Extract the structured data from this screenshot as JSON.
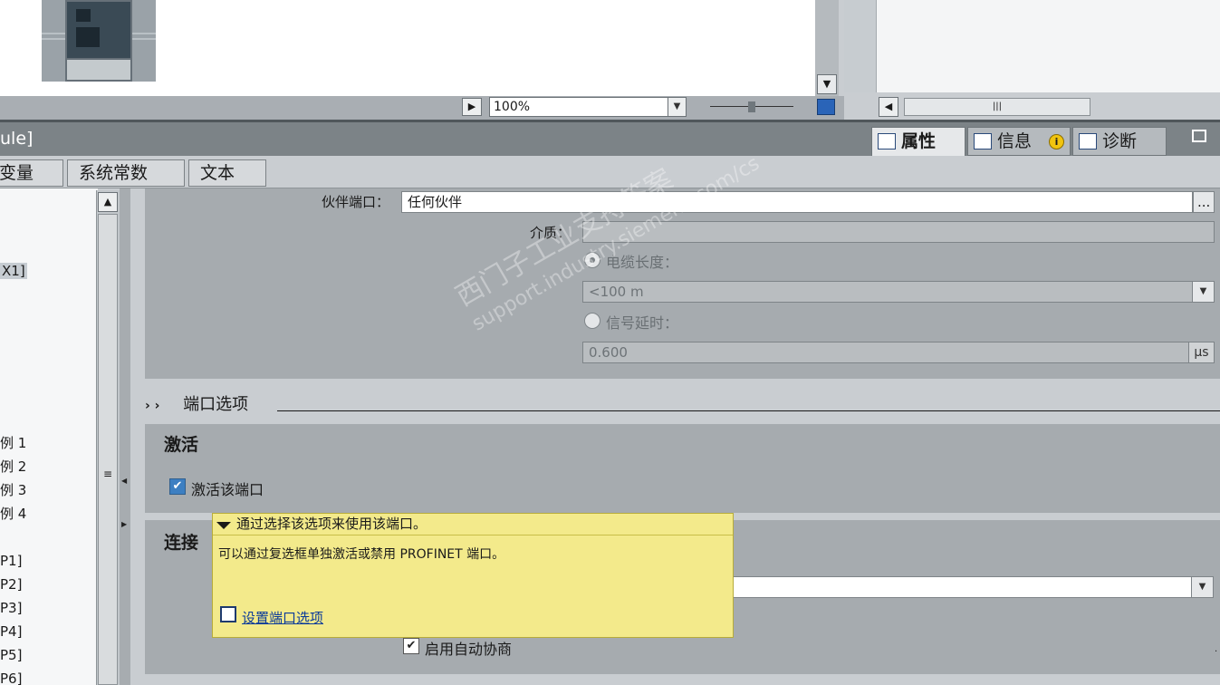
{
  "canvas": {
    "zoom_value": "100%"
  },
  "inspector": {
    "title": "ule]",
    "tabs": {
      "properties": "属性",
      "info": "信息",
      "diagnostics": "诊断"
    },
    "info_badge": "i"
  },
  "subtabs": [
    "变量",
    "系统常数",
    "文本"
  ],
  "tree": {
    "items": [
      "X1]",
      "例 1",
      "例 2",
      "例 3",
      "例 4",
      "P1]",
      "P2]",
      "P3]",
      "P4]",
      "P5]",
      "P6]"
    ]
  },
  "partner": {
    "partner_port_label": "伙伴端口：",
    "partner_port_value": "任何伙伴",
    "browse_label": "...",
    "medium_label": "介质：",
    "cable_length_label": "电缆长度：",
    "cable_length_value": "<100 m",
    "signal_delay_label": "信号延时：",
    "signal_delay_value": "0.600",
    "signal_delay_unit": "μs"
  },
  "port_options": {
    "section_title": "端口选项",
    "activation_title": "激活",
    "activate_label": "激活该端口",
    "activate_checked": true,
    "connection_title": "连接",
    "autoneg_label": "启用自动协商",
    "autoneg_checked": true
  },
  "tooltip": {
    "title": "通过选择该选项来使用该端口。",
    "body": "可以通过复选框单独激活或禁用 PROFINET 端口。",
    "link": "设置端口选项"
  },
  "watermark": {
    "line1": "西门子工业支持答案",
    "line2": "support.industry.siemens.com/cs"
  }
}
